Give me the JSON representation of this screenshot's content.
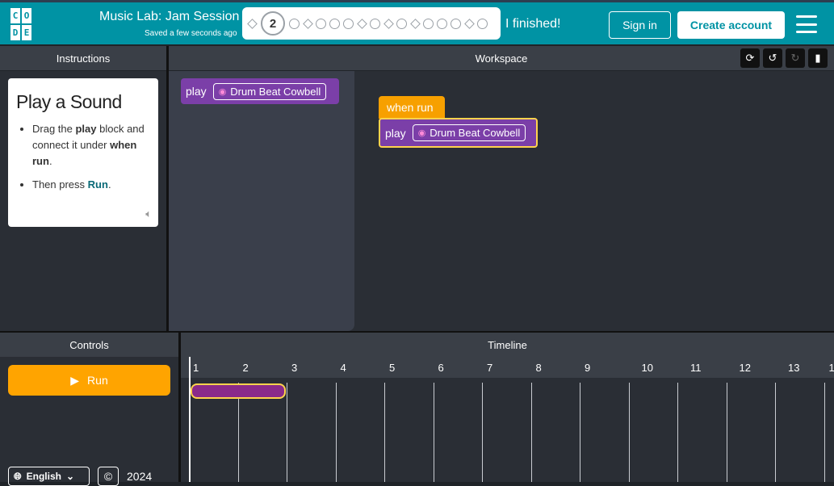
{
  "header": {
    "logo_letters": [
      "C",
      "O",
      "",
      "D",
      "E",
      ""
    ],
    "lab_title": "Music Lab: Jam Session",
    "saved_status": "Saved a few seconds ago",
    "current_level": "2",
    "finished_label": "I finished!",
    "signin_label": "Sign in",
    "create_label": "Create account"
  },
  "instructions": {
    "header": "Instructions",
    "title": "Play a Sound",
    "step1_pre": "Drag the ",
    "step1_bold1": "play",
    "step1_mid": " block and connect it under ",
    "step1_bold2": "when run",
    "step1_post": ".",
    "step2_pre": "Then press ",
    "step2_bold": "Run",
    "step2_post": "."
  },
  "workspace": {
    "header": "Workspace",
    "toolbox_block": {
      "label": "play",
      "sound": "Drum Beat Cowbell"
    },
    "when_run_label": "when run",
    "placed_block": {
      "label": "play",
      "sound": "Drum Beat Cowbell"
    }
  },
  "controls": {
    "header": "Controls",
    "run_label": "Run",
    "language": "English",
    "year": "2024"
  },
  "timeline": {
    "header": "Timeline",
    "measures": [
      "1",
      "2",
      "3",
      "4",
      "5",
      "6",
      "7",
      "8",
      "9",
      "10",
      "11",
      "12",
      "13",
      "1"
    ],
    "events": [
      {
        "start_measure": 1,
        "length_measures": 2
      }
    ]
  },
  "colors": {
    "brand": "#0093a4",
    "block_purple": "#7b3fa8",
    "when_run_orange": "#f7a000",
    "run_button": "#ffa400",
    "selection_outline": "#ffd34d"
  }
}
